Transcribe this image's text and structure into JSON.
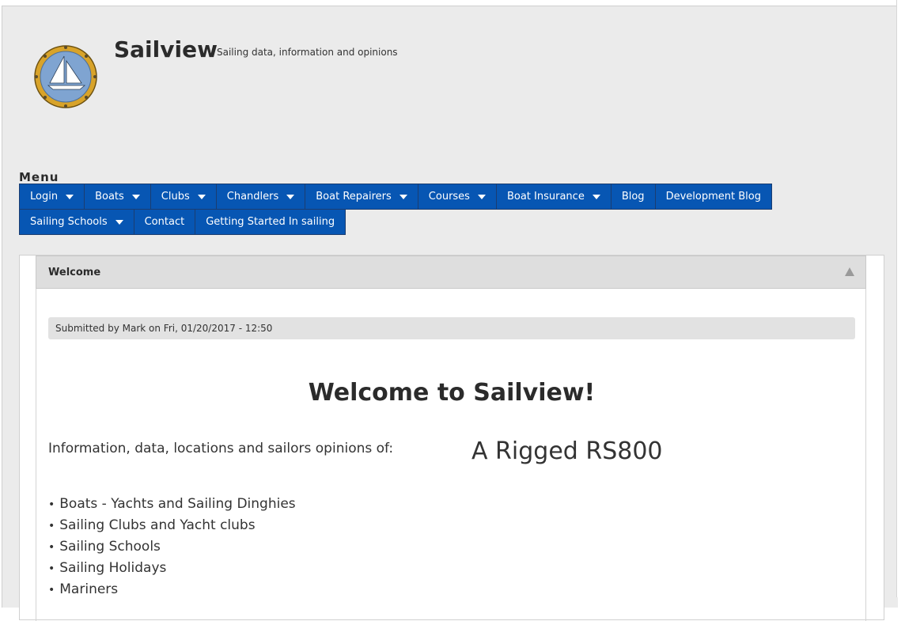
{
  "site": {
    "name": "Sailview",
    "slogan": "Sailing data, information and opinions"
  },
  "menu": {
    "title": "Menu",
    "items": [
      {
        "label": "Login",
        "dropdown": true
      },
      {
        "label": "Boats",
        "dropdown": true
      },
      {
        "label": "Clubs",
        "dropdown": true
      },
      {
        "label": "Chandlers",
        "dropdown": true
      },
      {
        "label": "Boat Repairers",
        "dropdown": true
      },
      {
        "label": "Courses",
        "dropdown": true
      },
      {
        "label": "Boat Insurance",
        "dropdown": true
      },
      {
        "label": "Blog",
        "dropdown": false
      },
      {
        "label": "Development Blog",
        "dropdown": false
      },
      {
        "label": "Sailing Schools",
        "dropdown": true
      },
      {
        "label": "Contact",
        "dropdown": false
      },
      {
        "label": "Getting Started In sailing",
        "dropdown": false
      }
    ]
  },
  "block": {
    "title": "Welcome",
    "submitted": "Submitted by Mark on Fri, 01/20/2017 - 12:50",
    "heading": "Welcome to Sailview!",
    "intro": "Information, data, locations and sailors opinions of:",
    "caption": "A Rigged RS800",
    "bullets": [
      "Boats - Yachts and Sailing Dinghies",
      "Sailing Clubs and Yacht clubs",
      "Sailing Schools",
      "Sailing Holidays",
      "Mariners"
    ]
  },
  "colors": {
    "nav_background": "#0756b3",
    "page_background": "#ebebeb",
    "header_background": "#dedede"
  },
  "icons": {
    "logo": "sailboat-porthole-logo",
    "dropdown": "caret-down-icon",
    "collapse": "triangle-up-icon"
  }
}
